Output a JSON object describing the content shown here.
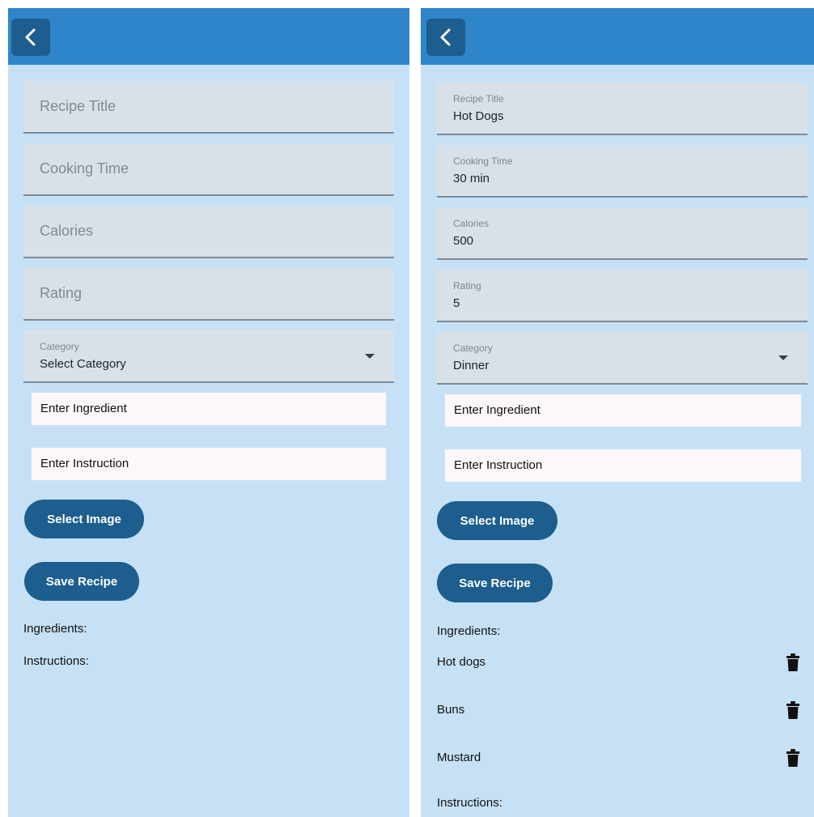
{
  "left": {
    "fields": {
      "title_placeholder": "Recipe Title",
      "cooking_placeholder": "Cooking Time",
      "calories_placeholder": "Calories",
      "rating_placeholder": "Rating",
      "category_label": "Category",
      "category_value": "Select Category"
    },
    "ingredient_input": "Enter Ingredient",
    "instruction_input": "Enter Instruction",
    "select_image": "Select Image",
    "save_recipe": "Save Recipe",
    "ingredients_heading": "Ingredients:",
    "instructions_heading": "Instructions:"
  },
  "right": {
    "fields": {
      "title_label": "Recipe Title",
      "title_value": "Hot Dogs",
      "cooking_label": "Cooking Time",
      "cooking_value": "30 min",
      "calories_label": "Calories",
      "calories_value": "500",
      "rating_label": "Rating",
      "rating_value": "5",
      "category_label": "Category",
      "category_value": "Dinner"
    },
    "ingredient_input": "Enter Ingredient",
    "instruction_input": "Enter Instruction",
    "select_image": "Select Image",
    "save_recipe": "Save Recipe",
    "ingredients_heading": "Ingredients:",
    "ingredients": [
      "Hot dogs",
      "Buns",
      "Mustard"
    ],
    "instructions_heading": "Instructions:"
  },
  "icons": {
    "back": "chevron-left-icon",
    "dropdown": "caret-down-icon",
    "delete": "trash-icon"
  },
  "colors": {
    "app_bar": "#2f85c9",
    "back_button": "#1d5e8e",
    "background": "#c6e1f6",
    "button": "#1d5e8e",
    "field_bg": "#d9e1e8"
  }
}
